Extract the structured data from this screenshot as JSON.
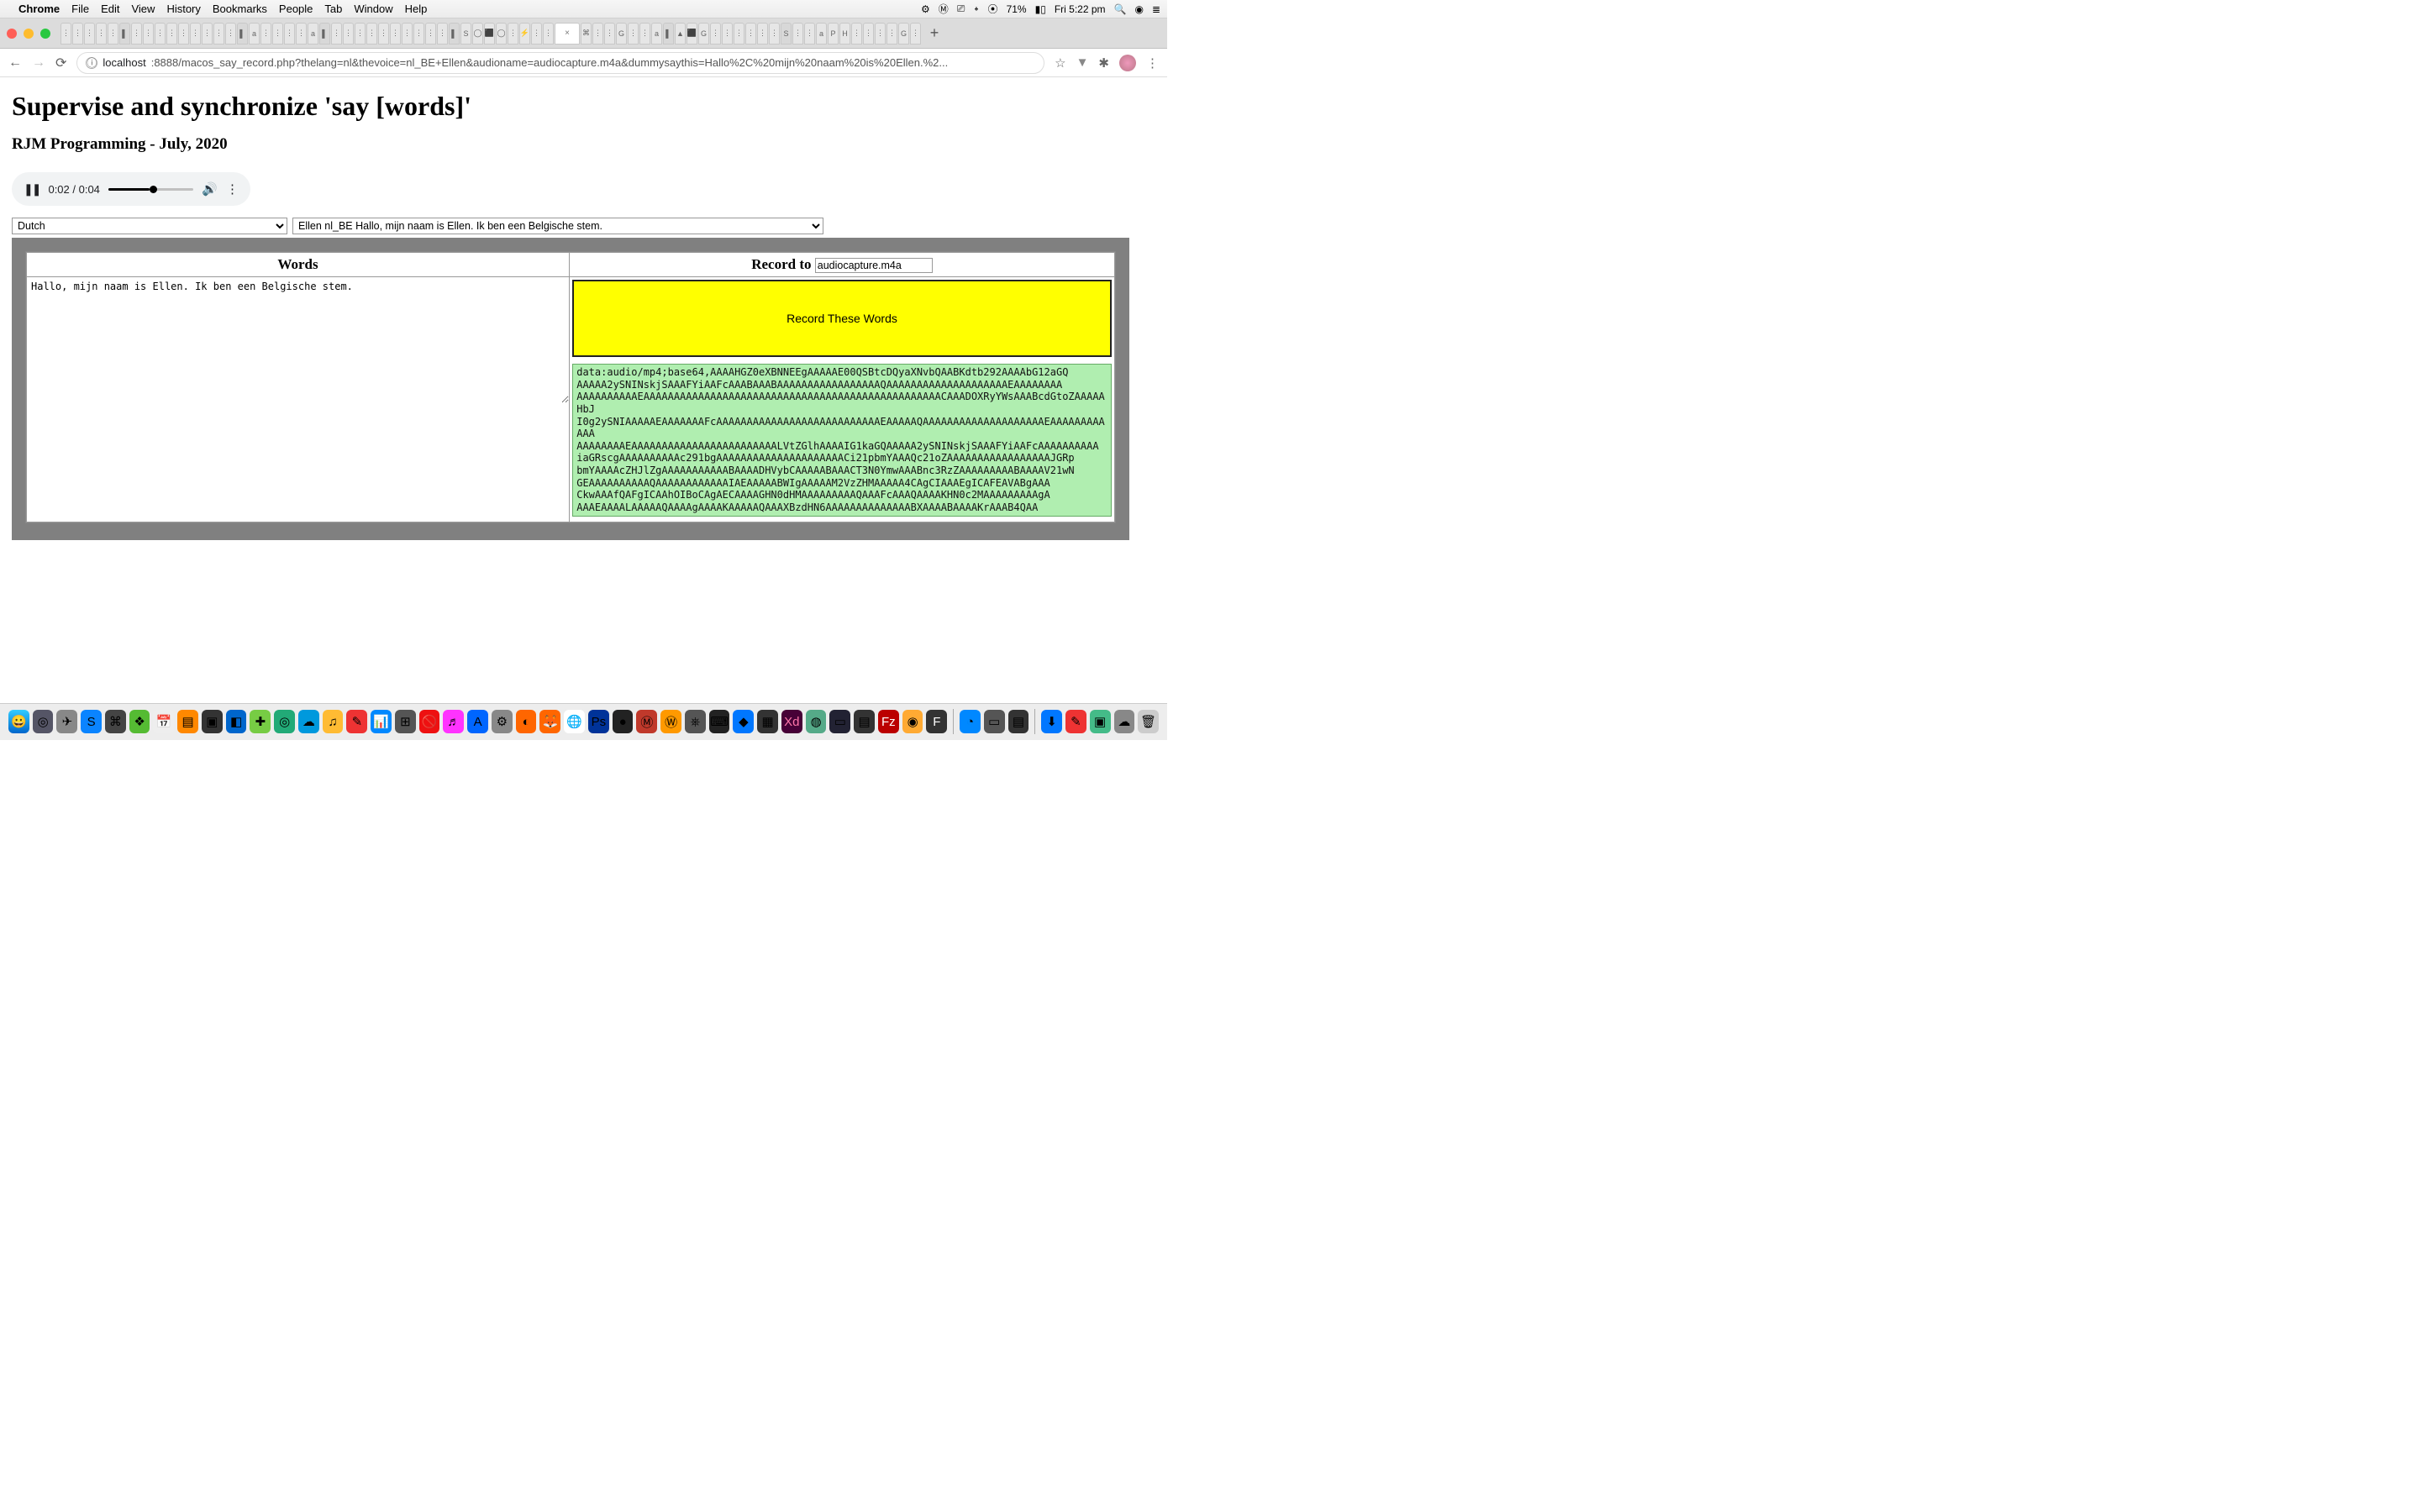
{
  "menubar": {
    "apple": "",
    "app": "Chrome",
    "items": [
      "File",
      "Edit",
      "View",
      "History",
      "Bookmarks",
      "People",
      "Tab",
      "Window",
      "Help"
    ],
    "battery": "71%",
    "clock": "Fri 5:22 pm"
  },
  "tabs": {
    "close_x": "×",
    "plus": "+"
  },
  "url": {
    "host": "localhost",
    "port_path": ":8888/macos_say_record.php?thelang=nl&thevoice=nl_BE+Ellen&audioname=audiocapture.m4a&dummysaythis=Hallo%2C%20mijn%20naam%20is%20Ellen.%2..."
  },
  "page": {
    "h1": "Supervise and synchronize 'say [words]'",
    "sub": "RJM Programming - July, 2020"
  },
  "audio": {
    "time": "0:02 / 0:04"
  },
  "selects": {
    "language": "Dutch",
    "voice": "Ellen nl_BE Hallo, mijn naam is Ellen. Ik ben een Belgische stem."
  },
  "table": {
    "words_header": "Words",
    "record_to_label": "Record to",
    "record_to_value": "audiocapture.m4a",
    "words_text": "Hallo, mijn naam is Ellen. Ik ben een Belgische stem.",
    "record_button": "Record These Words",
    "b64": "data:audio/mp4;base64,AAAAHGZ0eXBNNEEgAAAAAE00QSBtcDQyaXNvbQAABKdtb292AAAAbG12aGQ\nAAAAA2ySNINskjSAAAFYiAAFcAAABAAABAAAAAAAAAAAAAAAAAQAAAAAAAAAAAAAAAAAAAAEAAAAAAAA\nAAAAAAAAAAEAAAAAAAAAAAAAAAAAAAAAAAAAAAAAAAAAAAAAAAAAAAAAAAAACAAADOXRyYWsAAABcdGtoZAAAAAHbJ\nI0g2ySNIAAAAAEAAAAAAAFcAAAAAAAAAAAAAAAAAAAAAAAAAAAEAAAAAQAAAAAAAAAAAAAAAAAAAAEAAAAAAAAAAAA\nAAAAAAAAEAAAAAAAAAAAAAAAAAAAAAAAALVtZGlhAAAAIG1kaGQAAAAA2ySNINskjSAAAFYiAAFcAAAAAAAAAA\niaGRscgAAAAAAAAAAc291bgAAAAAAAAAAAAAAAAAAAAACi21pbmYAAAQc21oZAAAAAAAAAAAAAAAAAJGRp\nbmYAAAAcZHJlZgAAAAAAAAAAABAAAADHVybCAAAAABAAACT3N0YmwAAABnc3RzZAAAAAAAAABAAAAV21wN\nGEAAAAAAAAAAQAAAAAAAAAAAAIAEAAAAABWIgAAAAAM2VzZHMAAAAA4CAgCIAAAEgICAFEAVABgAAA\nCkwAAAfQAFgICAAhOIBoCAgAECAAAAGHN0dHMAAAAAAAAAQAAAFcAAAQAAAAKHN0c2MAAAAAAAAAgA\nAAAEAAAALAAAAAQAAAAgAAAAKAAAAAQAAAXBzdHN6AAAAAAAAAAAAAABXAAAABAAAAKrAAAB4QAA"
  },
  "icons": {
    "pause": "❚❚",
    "volume": "🔊",
    "more": "⋮",
    "star": "☆",
    "down": "▾",
    "ext": "✦",
    "menu": "⋮",
    "back": "←",
    "forward": "→",
    "reload": "⟳",
    "info": "ⓘ",
    "wifi": "􀙇",
    "bt": "󰂯",
    "search": "🔍",
    "siri": "◉",
    "list": "≣",
    "cast": "⎚"
  }
}
